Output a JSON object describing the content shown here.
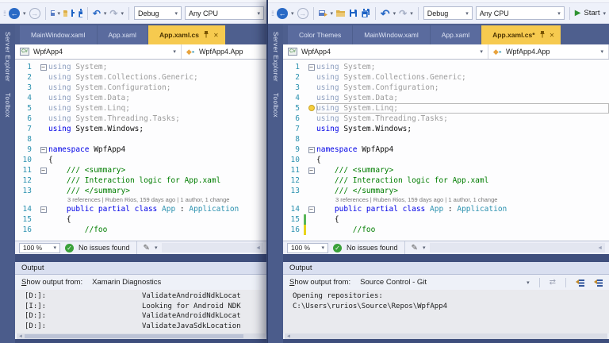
{
  "windows": [
    {
      "toolbar": {
        "debug_label": "Debug",
        "platform_label": "Any CPU"
      },
      "tabs": [
        {
          "label": "MainWindow.xaml",
          "active": false
        },
        {
          "label": "App.xaml",
          "active": false
        },
        {
          "label": "App.xaml.cs",
          "active": true
        }
      ],
      "side_tabs": [
        "Server Explorer",
        "Toolbox"
      ],
      "breadcrumb": {
        "project": "WpfApp4",
        "member": "WpfApp4.App"
      },
      "editor": {
        "zoom": "100 %",
        "issues": "No issues found",
        "codelens": "3 references | Ruben Rios, 159 days ago | 1 author, 1 change",
        "lines": [
          {
            "n": 1,
            "fold": 1,
            "segs": [
              [
                "kdim",
                "using"
              ],
              [
                "dim",
                " System;"
              ]
            ]
          },
          {
            "n": 2,
            "segs": [
              [
                "kdim",
                "using"
              ],
              [
                "dim",
                " System.Collections.Generic;"
              ]
            ]
          },
          {
            "n": 3,
            "segs": [
              [
                "kdim",
                "using"
              ],
              [
                "dim",
                " System.Configuration;"
              ]
            ]
          },
          {
            "n": 4,
            "segs": [
              [
                "kdim",
                "using"
              ],
              [
                "dim",
                " System.Data;"
              ]
            ]
          },
          {
            "n": 5,
            "segs": [
              [
                "kdim",
                "using"
              ],
              [
                "dim",
                " System.Linq;"
              ]
            ]
          },
          {
            "n": 6,
            "segs": [
              [
                "kdim",
                "using"
              ],
              [
                "dim",
                " System.Threading.Tasks;"
              ]
            ]
          },
          {
            "n": 7,
            "segs": [
              [
                "kw",
                "using"
              ],
              [
                "plain",
                " System.Windows;"
              ]
            ]
          },
          {
            "n": 8,
            "segs": []
          },
          {
            "n": 9,
            "fold": 1,
            "segs": [
              [
                "kw",
                "namespace"
              ],
              [
                "plain",
                " WpfApp4"
              ]
            ]
          },
          {
            "n": 10,
            "segs": [
              [
                "plain",
                "{"
              ]
            ]
          },
          {
            "n": 11,
            "fold": 1,
            "segs": [
              [
                "com",
                "    /// <summary>"
              ]
            ]
          },
          {
            "n": 12,
            "segs": [
              [
                "com",
                "    /// Interaction logic for App.xaml"
              ]
            ]
          },
          {
            "n": 13,
            "segs": [
              [
                "com",
                "    /// </summary>"
              ]
            ]
          },
          {
            "codelens": 1
          },
          {
            "n": 14,
            "fold": 1,
            "segs": [
              [
                "kw",
                "    public partial class "
              ],
              [
                "type",
                "App"
              ],
              [
                "plain",
                " : "
              ],
              [
                "type",
                "Application"
              ]
            ]
          },
          {
            "n": 15,
            "segs": [
              [
                "plain",
                "    {"
              ]
            ]
          },
          {
            "n": 16,
            "segs": [
              [
                "com",
                "        //foo"
              ]
            ]
          }
        ]
      },
      "output": {
        "title": "Output",
        "from_label": "Show output from:",
        "source": "Xamarin Diagnostics",
        "rows": [
          [
            "[D:]:",
            "ValidateAndroidNdkLocat"
          ],
          [
            "[I:]:",
            "Looking for Android NDK"
          ],
          [
            "[D:]:",
            "ValidateAndroidNdkLocat"
          ],
          [
            "[D:]:",
            "ValidateJavaSdkLocation"
          ]
        ]
      }
    },
    {
      "toolbar": {
        "debug_label": "Debug",
        "platform_label": "Any CPU",
        "start_label": "Start"
      },
      "tabs": [
        {
          "label": "Color Themes",
          "active": false
        },
        {
          "label": "MainWindow.xaml",
          "active": false
        },
        {
          "label": "App.xaml",
          "active": false
        },
        {
          "label": "App.xaml.cs*",
          "active": true
        }
      ],
      "side_tabs": [
        "Server Explorer",
        "Toolbox"
      ],
      "breadcrumb": {
        "project": "WpfApp4",
        "member": "WpfApp4.App"
      },
      "editor": {
        "zoom": "100 %",
        "issues": "No issues found",
        "codelens": "3 references | Ruben Rios, 159 days ago | 1 author, 1 change",
        "lines": [
          {
            "n": 1,
            "fold": 1,
            "segs": [
              [
                "kdim",
                "using"
              ],
              [
                "dim",
                " System;"
              ]
            ]
          },
          {
            "n": 2,
            "segs": [
              [
                "kdim",
                "using"
              ],
              [
                "dim",
                " System.Collections.Generic;"
              ]
            ]
          },
          {
            "n": 3,
            "segs": [
              [
                "kdim",
                "using"
              ],
              [
                "dim",
                " System.Configuration;"
              ]
            ]
          },
          {
            "n": 4,
            "segs": [
              [
                "kdim",
                "using"
              ],
              [
                "dim",
                " System.Data;"
              ]
            ]
          },
          {
            "n": 5,
            "bulb": 1,
            "box": 1,
            "segs": [
              [
                "kdim",
                "using"
              ],
              [
                "dim",
                " System.Linq;"
              ]
            ]
          },
          {
            "n": 6,
            "segs": [
              [
                "kdim",
                "using"
              ],
              [
                "dim",
                " System.Threading.Tasks;"
              ]
            ]
          },
          {
            "n": 7,
            "segs": [
              [
                "kw",
                "using"
              ],
              [
                "plain",
                " System.Windows;"
              ]
            ]
          },
          {
            "n": 8,
            "segs": []
          },
          {
            "n": 9,
            "fold": 1,
            "segs": [
              [
                "kw",
                "namespace"
              ],
              [
                "plain",
                " WpfApp4"
              ]
            ]
          },
          {
            "n": 10,
            "segs": [
              [
                "plain",
                "{"
              ]
            ]
          },
          {
            "n": 11,
            "fold": 1,
            "segs": [
              [
                "com",
                "    /// <summary>"
              ]
            ]
          },
          {
            "n": 12,
            "segs": [
              [
                "com",
                "    /// Interaction logic for App.xaml"
              ]
            ]
          },
          {
            "n": 13,
            "segs": [
              [
                "com",
                "    /// </summary>"
              ]
            ]
          },
          {
            "codelens": 1
          },
          {
            "n": 14,
            "fold": 1,
            "segs": [
              [
                "kw",
                "    public partial class "
              ],
              [
                "type",
                "App"
              ],
              [
                "plain",
                " : "
              ],
              [
                "type",
                "Application"
              ]
            ]
          },
          {
            "n": 15,
            "bar": "green",
            "segs": [
              [
                "plain",
                "    {"
              ]
            ]
          },
          {
            "n": 16,
            "bar": "yellow",
            "segs": [
              [
                "com",
                "        //foo"
              ]
            ]
          }
        ]
      },
      "output": {
        "title": "Output",
        "from_label": "Show output from:",
        "source": "Source Control - Git",
        "rows": [
          [
            "Opening repositories:"
          ],
          [
            "C:\\Users\\rurios\\Source\\Repos\\WpfApp4"
          ]
        ]
      }
    }
  ]
}
